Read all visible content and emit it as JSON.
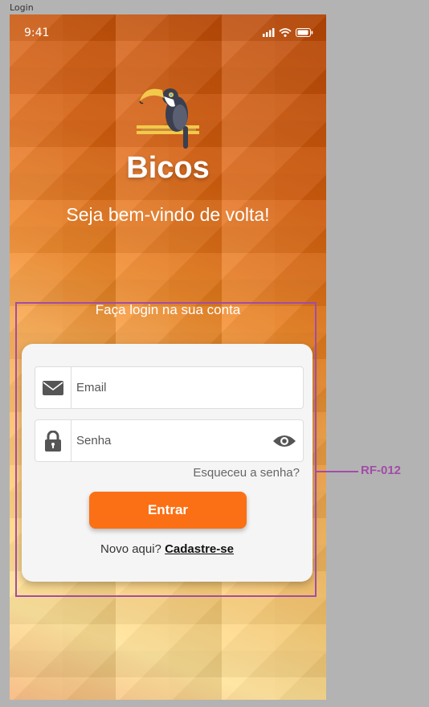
{
  "frame": {
    "label": "Login"
  },
  "status_bar": {
    "time": "9:41",
    "icons": [
      "signal-icon",
      "wifi-icon",
      "battery-icon"
    ]
  },
  "app": {
    "name": "Bicos",
    "logo": "toucan-logo"
  },
  "welcome": "Seja bem-vindo de volta!",
  "login_prompt": "Faça login na sua conta",
  "form": {
    "email": {
      "placeholder": "Email",
      "icon": "envelope-icon"
    },
    "password": {
      "placeholder": "Senha",
      "icon": "lock-icon",
      "toggle_icon": "eye-icon"
    },
    "forgot_label": "Esqueceu a senha?",
    "submit_label": "Entrar",
    "signup_prompt": "Novo aqui?",
    "signup_link": "Cadastre-se"
  },
  "annotation": {
    "label": "RF-012"
  },
  "colors": {
    "accent": "#fb7015",
    "annotation": "#a24ca8",
    "card": "#f5f5f5"
  }
}
